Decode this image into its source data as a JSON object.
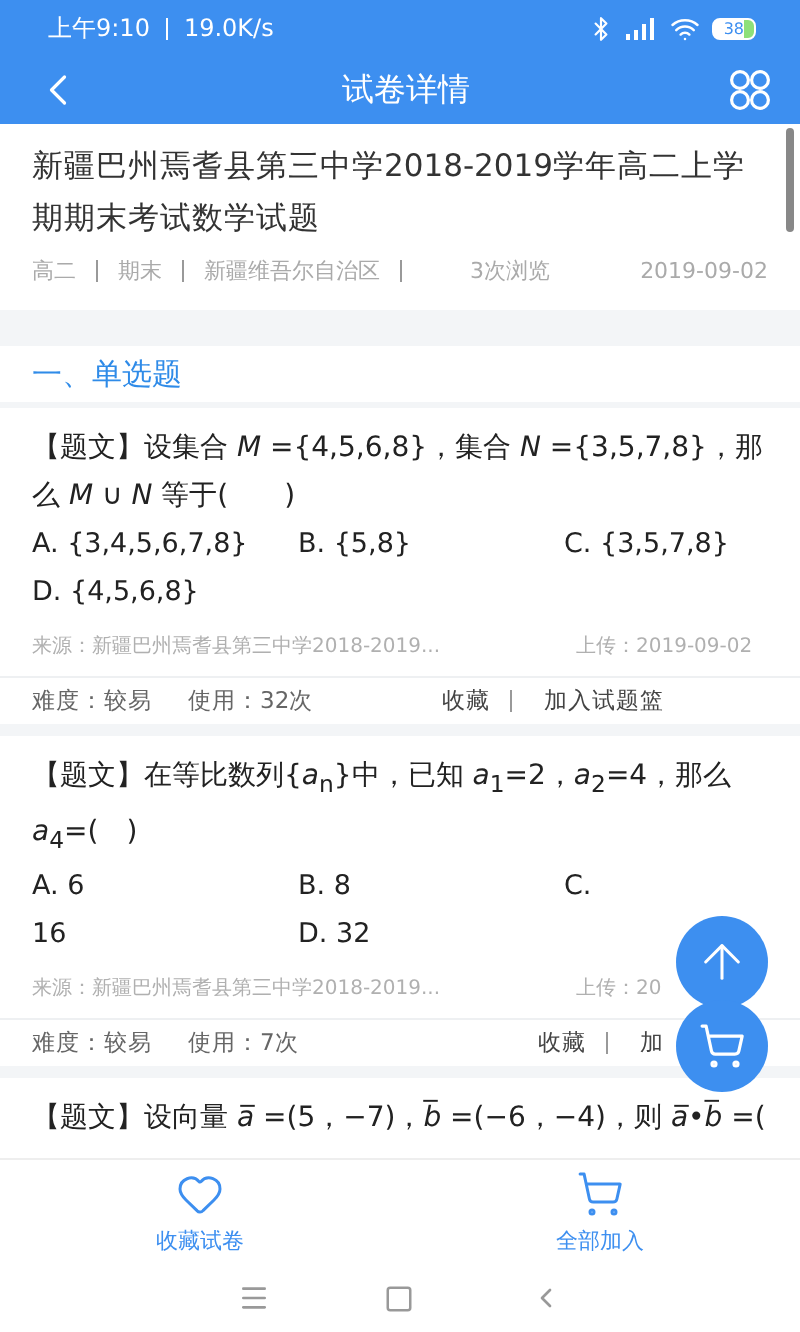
{
  "status_bar": {
    "time": "上午9:10",
    "speed": "19.0K/s",
    "battery": "38"
  },
  "header": {
    "title": "试卷详情"
  },
  "paper": {
    "title": "新疆巴州焉耆县第三中学2018-2019学年高二上学期期末考试数学试题",
    "tags": [
      "高二",
      "期末",
      "新疆维吾尔自治区"
    ],
    "views": "3次浏览",
    "date": "2019-09-02"
  },
  "section": {
    "title": "一、单选题"
  },
  "questions": [
    {
      "text": "【题文】设集合 *M* ={4,5,6,8}，集合 *N* ={3,5,7,8}，那么 *M* ∪ *N* 等于(　　)",
      "options": [
        "A. {3,4,5,6,7,8}",
        "B. {5,8}",
        "C. {3,5,7,8}",
        "D. {4,5,6,8}"
      ],
      "source": "来源：新疆巴州焉耆县第三中学2018-2019...",
      "upload": "上传：2019-09-02",
      "difficulty": "难度：较易",
      "usage": "使用：32次",
      "favorite": "收藏",
      "add": "加入试题篮"
    },
    {
      "text": "【题文】在等比数列{*a*$_{n}$}中，已知 *a*$_{1}$=2，*a*$_{2}$=4，那么 *a*$_{4}$=(　)",
      "options": [
        "A. 6",
        "B. 8",
        "C.",
        "16",
        "D. 32"
      ],
      "source": "来源：新疆巴州焉耆县第三中学2018-2019...",
      "upload": "上传：20",
      "difficulty": "难度：较易",
      "usage": "使用：7次",
      "favorite": "收藏",
      "add": "加"
    },
    {
      "text": "【题文】设向量 *a̅* =(5，−7)，*b̅* =(−6，−4)，则 *a̅*•*b̅* =("
    }
  ],
  "bottom_tabs": [
    {
      "kind": "favorite",
      "label": "收藏试卷"
    },
    {
      "kind": "cart",
      "label": "全部加入"
    }
  ]
}
